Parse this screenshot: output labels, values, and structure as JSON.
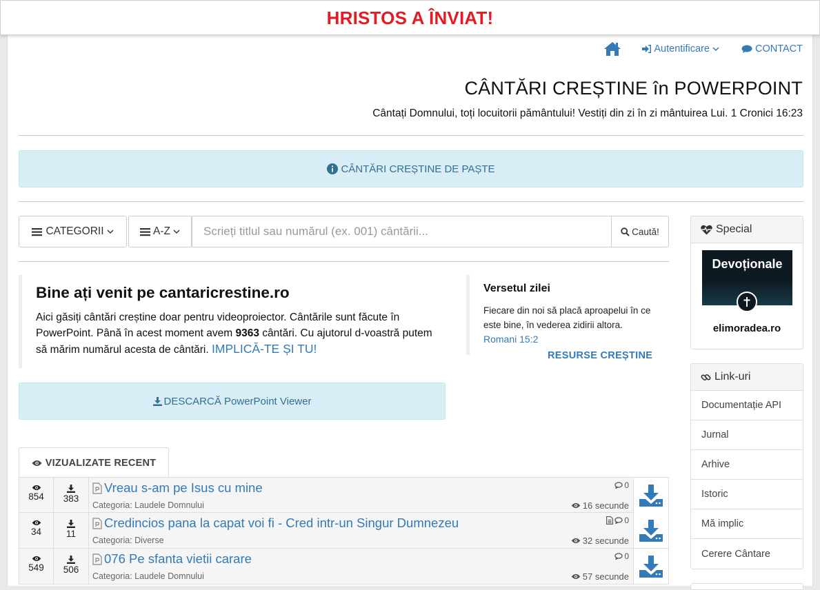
{
  "banner": {
    "text": "HRISTOS A ÎNVIAT!"
  },
  "nav": {
    "home_icon": "home-icon",
    "auth_label": "Autentificare",
    "contact_label": "CONTACT"
  },
  "header": {
    "title": "CÂNTĂRI CREȘTINE în POWERPOINT",
    "subtitle": "Cântați Domnului, toți locuitorii pământului! Vestiți din zi în zi mântuirea Lui. 1 Cronici 16:23"
  },
  "alert": {
    "label": "CÂNTĂRI CREȘTINE DE PAȘTE"
  },
  "toolbar": {
    "categories_label": "CATEGORII",
    "az_label": "A-Z",
    "search_placeholder": "Scrieți titlul sau numărul (ex. 001) cântării...",
    "search_button": "Caută!"
  },
  "welcome": {
    "title": "Bine ați venit pe cantaricrestine.ro",
    "text_before": "Aici găsiți cântări creștine doar pentru videoproiector. Cântările sunt făcute în PowerPoint. Până în acest moment avem ",
    "count": "9363",
    "text_after": " cântări. Cu ajutorul d-voastră putem să mărim numărul acesta de cântări. ",
    "link": "IMPLICĂ-TE ȘI TU!"
  },
  "verse": {
    "heading": "Versetul zilei",
    "text": "Fiecare din noi să placă aproapelui în ce este bine, în vederea zidirii altora.",
    "reference": "Romani 15:2",
    "resources_link": "RESURSE CREȘTINE"
  },
  "download": {
    "label": "DESCARCĂ PowerPoint Viewer"
  },
  "recent": {
    "tab_label": "VIZUALIZATE RECENT",
    "rows": [
      {
        "views": "854",
        "downloads": "383",
        "title": "Vreau s-am pe Isus cu mine",
        "category": "Categoria: Laudele Domnului",
        "comments": "0",
        "time": "16 secunde",
        "has_text_icon": false
      },
      {
        "views": "34",
        "downloads": "11",
        "title": "Credincios pana la capat voi fi - Cred intr-un Singur Dumnezeu",
        "category": "Categoria: Diverse",
        "comments": "0",
        "time": "32 secunde",
        "has_text_icon": true
      },
      {
        "views": "549",
        "downloads": "506",
        "title": "076 Pe sfanta vietii carare",
        "category": "Categoria: Laudele Domnului",
        "comments": "0",
        "time": "57 secunde",
        "has_text_icon": false
      }
    ]
  },
  "sidebar": {
    "special_title": "Special",
    "devotional_title": "Devoționale",
    "devotional_site": "elimoradea.ro",
    "links_title": "Link-uri",
    "links": [
      "Documentație API",
      "Jurnal",
      "Arhive",
      "Istoric",
      "Mă implic",
      "Cerere Cântare"
    ]
  },
  "colors": {
    "banner_red": "#e41b23",
    "link_blue": "#337ab7",
    "alert_bg": "#d9edf7",
    "alert_text": "#31708f"
  }
}
